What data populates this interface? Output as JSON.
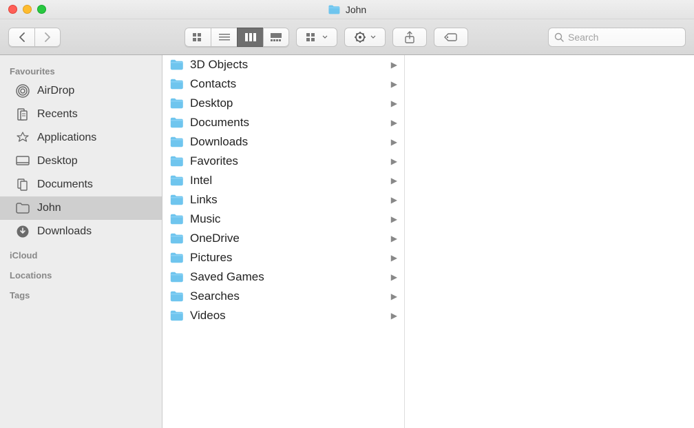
{
  "window": {
    "title": "John"
  },
  "search": {
    "placeholder": "Search"
  },
  "sidebar": {
    "sections": [
      {
        "header": "Favourites",
        "items": [
          {
            "icon": "airdrop",
            "label": "AirDrop",
            "active": false
          },
          {
            "icon": "recents",
            "label": "Recents",
            "active": false
          },
          {
            "icon": "applications",
            "label": "Applications",
            "active": false
          },
          {
            "icon": "desktop",
            "label": "Desktop",
            "active": false
          },
          {
            "icon": "documents",
            "label": "Documents",
            "active": false
          },
          {
            "icon": "folder",
            "label": "John",
            "active": true
          },
          {
            "icon": "downloads",
            "label": "Downloads",
            "active": false
          }
        ]
      },
      {
        "header": "iCloud",
        "items": []
      },
      {
        "header": "Locations",
        "items": []
      },
      {
        "header": "Tags",
        "items": []
      }
    ]
  },
  "column0": {
    "items": [
      {
        "name": "3D Objects"
      },
      {
        "name": "Contacts"
      },
      {
        "name": "Desktop"
      },
      {
        "name": "Documents"
      },
      {
        "name": "Downloads"
      },
      {
        "name": "Favorites"
      },
      {
        "name": "Intel"
      },
      {
        "name": "Links"
      },
      {
        "name": "Music"
      },
      {
        "name": "OneDrive"
      },
      {
        "name": "Pictures"
      },
      {
        "name": "Saved Games"
      },
      {
        "name": "Searches"
      },
      {
        "name": "Videos"
      }
    ]
  }
}
